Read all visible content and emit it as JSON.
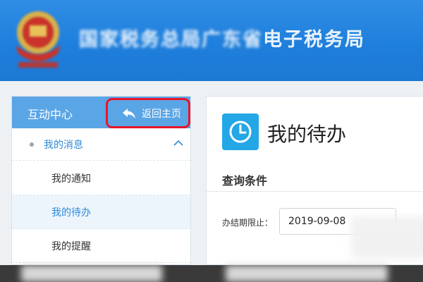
{
  "header": {
    "title_blurred": "国家税务总局广东省",
    "title_clear": "电子税务局",
    "emblem_icon": "national-emblem-icon"
  },
  "sidebar": {
    "title": "互动中心",
    "back_button": {
      "label": "返回主页",
      "icon": "back-arrow-icon"
    },
    "group": {
      "label": "我的消息",
      "icon": "chevron-up-icon",
      "expanded": true
    },
    "items": [
      {
        "label": "我的通知",
        "active": false
      },
      {
        "label": "我的待办",
        "active": true
      },
      {
        "label": "我的提醒",
        "active": false
      }
    ]
  },
  "main": {
    "icon": "clock-icon",
    "title": "我的待办",
    "section_title": "查询条件",
    "deadline_field": {
      "label": "办结期限止：",
      "value": "2019-09-08"
    }
  },
  "colors": {
    "header_blue": "#1f7fdc",
    "sidebar_head": "#5aa5e6",
    "highlight_red": "#e8152b",
    "link_blue": "#2c8ad8",
    "clock_tile": "#24a7e7"
  }
}
